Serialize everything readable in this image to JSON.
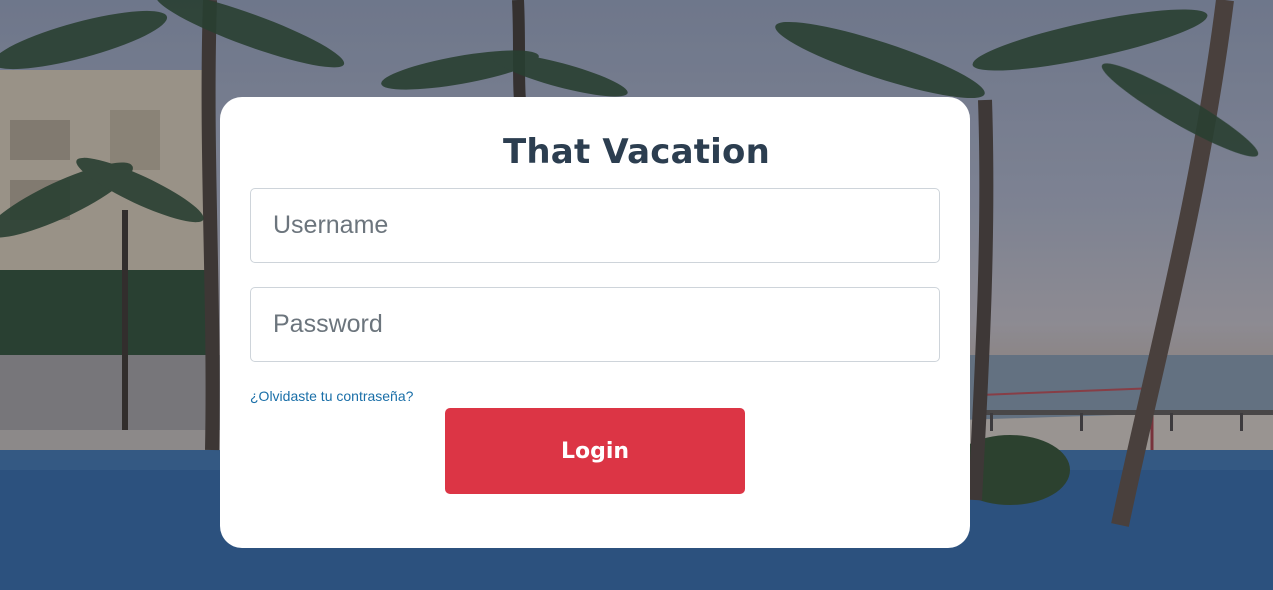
{
  "app": {
    "title": "That Vacation"
  },
  "form": {
    "username": {
      "value": "",
      "placeholder": "Username"
    },
    "password": {
      "value": "",
      "placeholder": "Password"
    },
    "forgot_password_label": "¿Olvidaste tu contraseña?",
    "login_label": "Login"
  },
  "background": {
    "scene": "tropical-resort-pool-and-beach-photo"
  },
  "colors": {
    "accent": "#dc3545",
    "title": "#2c3e50",
    "link": "#1a6fa8",
    "card": "#ffffff"
  }
}
